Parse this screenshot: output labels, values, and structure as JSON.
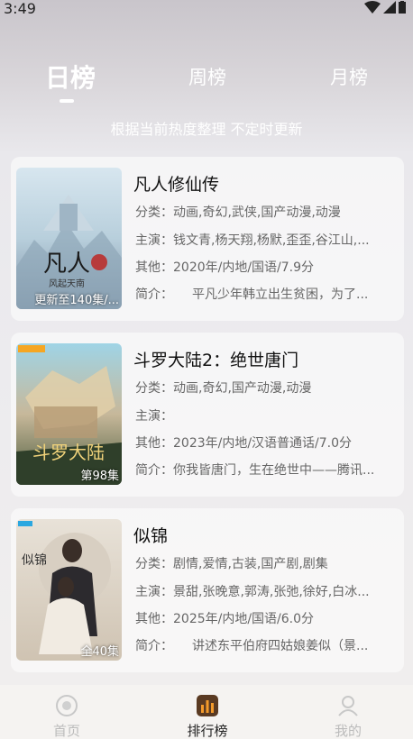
{
  "status": {
    "time": "3:49"
  },
  "tabs": [
    {
      "label": "日榜",
      "active": true
    },
    {
      "label": "周榜",
      "active": false
    },
    {
      "label": "月榜",
      "active": false
    }
  ],
  "subtitle": "根据当前热度整理 不定时更新",
  "items": [
    {
      "title": "凡人修仙传",
      "badge": "更新至140集/...",
      "genre": "分类：动画,奇幻,武侠,国产动漫,动漫",
      "cast": "主演：钱文青,杨天翔,杨默,歪歪,谷江山,...",
      "other": "其他：2020年/内地/国语/7.9分",
      "intro": "简介：　　平凡少年韩立出生贫困，为了..."
    },
    {
      "title": "斗罗大陆2：绝世唐门",
      "badge": "第98集",
      "genre": "分类：动画,奇幻,国产动漫,动漫",
      "cast": "主演：",
      "other": "其他：2023年/内地/汉语普通话/7.0分",
      "intro": "简介：你我皆唐门，生在绝世中——腾讯..."
    },
    {
      "title": "似锦",
      "badge": "全40集",
      "genre": "分类：剧情,爱情,古装,国产剧,剧集",
      "cast": "主演：景甜,张晚意,郭涛,张弛,徐好,白冰...",
      "other": "其他：2025年/内地/国语/6.0分",
      "intro": "简介：　　讲述东平伯府四姑娘姜似（景..."
    }
  ],
  "nav": [
    {
      "label": "首页",
      "icon": "home-icon",
      "active": false
    },
    {
      "label": "排行榜",
      "icon": "ranking-icon",
      "active": true
    },
    {
      "label": "我的",
      "icon": "profile-icon",
      "active": false
    }
  ],
  "colors": {
    "accent": "#ffffff",
    "active_nav": "#222222",
    "inactive_nav": "#bbbbbb"
  }
}
